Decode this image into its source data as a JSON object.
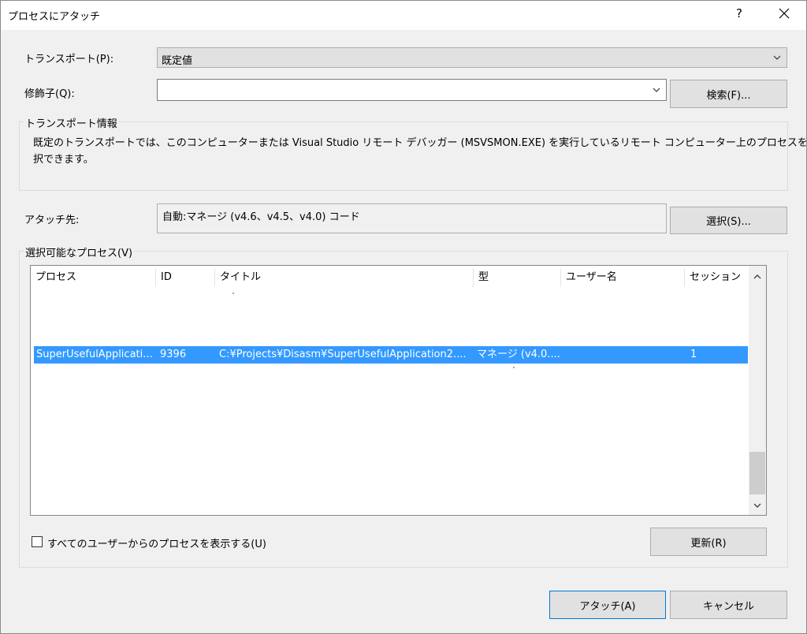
{
  "dialog": {
    "title": "プロセスにアタッチ",
    "help_glyph": "?"
  },
  "transport": {
    "label": "トランスポート(P):",
    "value": "既定値"
  },
  "qualifier": {
    "label": "修飾子(Q):",
    "value": "",
    "find_button": "検索(F)..."
  },
  "transport_info": {
    "group_label": "トランスポート情報",
    "text_line1": "既定のトランスポートでは、このコンピューターまたは Visual Studio リモート デバッガー (MSVSMON.EXE) を実行しているリモート コンピューター上のプロセスを選",
    "text_line2": "択できます。"
  },
  "attach_to": {
    "label": "アタッチ先:",
    "value": "自動:マネージ (v4.6、v4.5、v4.0) コード",
    "select_button": "選択(S)..."
  },
  "processes": {
    "group_label": "選択可能なプロセス(V)",
    "columns": [
      "プロセス",
      "ID",
      "タイトル",
      "型",
      "ユーザー名",
      "セッション"
    ],
    "selected_row": {
      "process": "SuperUsefulApplicati...",
      "id": "9396",
      "title": "C:¥Projects¥Disasm¥SuperUsefulApplication2....",
      "type": "マネージ (v4.0....",
      "user": "",
      "session": "1"
    },
    "show_all_users_label": "すべてのユーザーからのプロセスを表示する(U)",
    "show_all_users_checked": false,
    "refresh_button": "更新(R)"
  },
  "footer": {
    "attach_button": "アタッチ(A)",
    "cancel_button": "キャンセル"
  },
  "colors": {
    "selection": "#3399ff",
    "primary_border": "#0078d7"
  }
}
